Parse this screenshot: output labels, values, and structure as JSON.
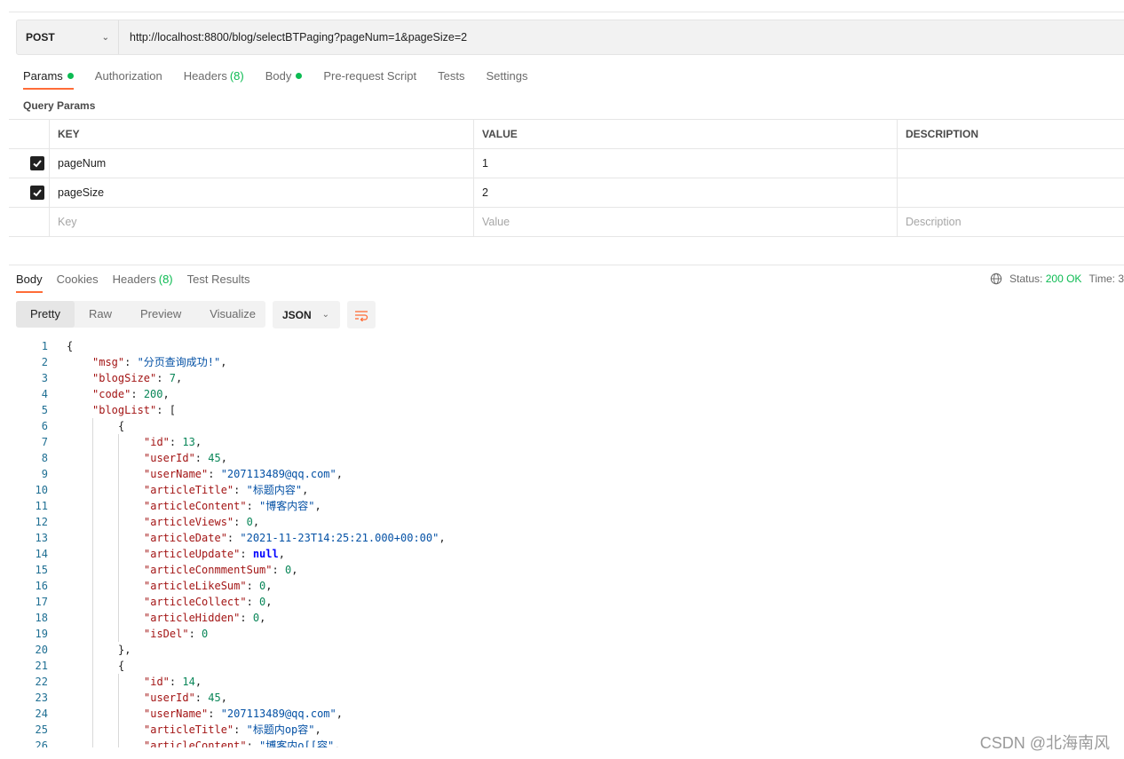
{
  "request": {
    "method": "POST",
    "url": "http://localhost:8800/blog/selectBTPaging?pageNum=1&pageSize=2"
  },
  "request_tabs": [
    {
      "label": "Params",
      "dot": true,
      "active": true
    },
    {
      "label": "Authorization"
    },
    {
      "label": "Headers",
      "count": "(8)"
    },
    {
      "label": "Body",
      "dot": true
    },
    {
      "label": "Pre-request Script"
    },
    {
      "label": "Tests"
    },
    {
      "label": "Settings"
    }
  ],
  "query_params": {
    "title": "Query Params",
    "headers": [
      "KEY",
      "VALUE",
      "DESCRIPTION"
    ],
    "rows": [
      {
        "checked": true,
        "key": "pageNum",
        "value": "1",
        "description": ""
      },
      {
        "checked": true,
        "key": "pageSize",
        "value": "2",
        "description": ""
      }
    ],
    "placeholders": {
      "key": "Key",
      "value": "Value",
      "description": "Description"
    }
  },
  "response_tabs": [
    {
      "label": "Body",
      "active": true
    },
    {
      "label": "Cookies"
    },
    {
      "label": "Headers",
      "count": "(8)"
    },
    {
      "label": "Test Results"
    }
  ],
  "status": {
    "label": "Status:",
    "value": "200 OK",
    "time_label": "Time: 3"
  },
  "view_modes": [
    "Pretty",
    "Raw",
    "Preview",
    "Visualize"
  ],
  "format": "JSON",
  "icons": {
    "method_dropdown": "chevron-down-icon",
    "format_dropdown": "chevron-down-icon",
    "wrap": "wrap-lines-icon",
    "globe": "globe-icon",
    "check": "check-icon"
  },
  "colors": {
    "accent": "#ff6c37",
    "success": "#0cbb52"
  },
  "code_lines": [
    {
      "n": "1",
      "ind": 0,
      "p": [
        [
          "p",
          "{"
        ]
      ]
    },
    {
      "n": "2",
      "ind": 1,
      "p": [
        [
          "k",
          "\"msg\""
        ],
        [
          "p",
          ": "
        ],
        [
          "s",
          "\"分页查询成功!\""
        ],
        [
          "p",
          ","
        ]
      ]
    },
    {
      "n": "3",
      "ind": 1,
      "p": [
        [
          "k",
          "\"blogSize\""
        ],
        [
          "p",
          ": "
        ],
        [
          "n",
          "7"
        ],
        [
          "p",
          ","
        ]
      ]
    },
    {
      "n": "4",
      "ind": 1,
      "p": [
        [
          "k",
          "\"code\""
        ],
        [
          "p",
          ": "
        ],
        [
          "n",
          "200"
        ],
        [
          "p",
          ","
        ]
      ]
    },
    {
      "n": "5",
      "ind": 1,
      "p": [
        [
          "k",
          "\"blogList\""
        ],
        [
          "p",
          ": ["
        ]
      ]
    },
    {
      "n": "6",
      "ind": 2,
      "p": [
        [
          "p",
          "{"
        ]
      ]
    },
    {
      "n": "7",
      "ind": 3,
      "p": [
        [
          "k",
          "\"id\""
        ],
        [
          "p",
          ": "
        ],
        [
          "n",
          "13"
        ],
        [
          "p",
          ","
        ]
      ]
    },
    {
      "n": "8",
      "ind": 3,
      "p": [
        [
          "k",
          "\"userId\""
        ],
        [
          "p",
          ": "
        ],
        [
          "n",
          "45"
        ],
        [
          "p",
          ","
        ]
      ]
    },
    {
      "n": "9",
      "ind": 3,
      "p": [
        [
          "k",
          "\"userName\""
        ],
        [
          "p",
          ": "
        ],
        [
          "s",
          "\"207113489@qq.com\""
        ],
        [
          "p",
          ","
        ]
      ]
    },
    {
      "n": "10",
      "ind": 3,
      "p": [
        [
          "k",
          "\"articleTitle\""
        ],
        [
          "p",
          ": "
        ],
        [
          "s",
          "\"标题内容\""
        ],
        [
          "p",
          ","
        ]
      ]
    },
    {
      "n": "11",
      "ind": 3,
      "p": [
        [
          "k",
          "\"articleContent\""
        ],
        [
          "p",
          ": "
        ],
        [
          "s",
          "\"博客内容\""
        ],
        [
          "p",
          ","
        ]
      ]
    },
    {
      "n": "12",
      "ind": 3,
      "p": [
        [
          "k",
          "\"articleViews\""
        ],
        [
          "p",
          ": "
        ],
        [
          "n",
          "0"
        ],
        [
          "p",
          ","
        ]
      ]
    },
    {
      "n": "13",
      "ind": 3,
      "p": [
        [
          "k",
          "\"articleDate\""
        ],
        [
          "p",
          ": "
        ],
        [
          "s",
          "\"2021-11-23T14:25:21.000+00:00\""
        ],
        [
          "p",
          ","
        ]
      ]
    },
    {
      "n": "14",
      "ind": 3,
      "p": [
        [
          "k",
          "\"articleUpdate\""
        ],
        [
          "p",
          ": "
        ],
        [
          "kw",
          "null"
        ],
        [
          "p",
          ","
        ]
      ]
    },
    {
      "n": "15",
      "ind": 3,
      "p": [
        [
          "k",
          "\"articleConmmentSum\""
        ],
        [
          "p",
          ": "
        ],
        [
          "n",
          "0"
        ],
        [
          "p",
          ","
        ]
      ]
    },
    {
      "n": "16",
      "ind": 3,
      "p": [
        [
          "k",
          "\"articleLikeSum\""
        ],
        [
          "p",
          ": "
        ],
        [
          "n",
          "0"
        ],
        [
          "p",
          ","
        ]
      ]
    },
    {
      "n": "17",
      "ind": 3,
      "p": [
        [
          "k",
          "\"articleCollect\""
        ],
        [
          "p",
          ": "
        ],
        [
          "n",
          "0"
        ],
        [
          "p",
          ","
        ]
      ]
    },
    {
      "n": "18",
      "ind": 3,
      "p": [
        [
          "k",
          "\"articleHidden\""
        ],
        [
          "p",
          ": "
        ],
        [
          "n",
          "0"
        ],
        [
          "p",
          ","
        ]
      ]
    },
    {
      "n": "19",
      "ind": 3,
      "p": [
        [
          "k",
          "\"isDel\""
        ],
        [
          "p",
          ": "
        ],
        [
          "n",
          "0"
        ]
      ]
    },
    {
      "n": "20",
      "ind": 2,
      "p": [
        [
          "p",
          "},"
        ]
      ]
    },
    {
      "n": "21",
      "ind": 2,
      "p": [
        [
          "p",
          "{"
        ]
      ]
    },
    {
      "n": "22",
      "ind": 3,
      "p": [
        [
          "k",
          "\"id\""
        ],
        [
          "p",
          ": "
        ],
        [
          "n",
          "14"
        ],
        [
          "p",
          ","
        ]
      ]
    },
    {
      "n": "23",
      "ind": 3,
      "p": [
        [
          "k",
          "\"userId\""
        ],
        [
          "p",
          ": "
        ],
        [
          "n",
          "45"
        ],
        [
          "p",
          ","
        ]
      ]
    },
    {
      "n": "24",
      "ind": 3,
      "p": [
        [
          "k",
          "\"userName\""
        ],
        [
          "p",
          ": "
        ],
        [
          "s",
          "\"207113489@qq.com\""
        ],
        [
          "p",
          ","
        ]
      ]
    },
    {
      "n": "25",
      "ind": 3,
      "p": [
        [
          "k",
          "\"articleTitle\""
        ],
        [
          "p",
          ": "
        ],
        [
          "s",
          "\"标题内op容\""
        ],
        [
          "p",
          ","
        ]
      ]
    },
    {
      "n": "26",
      "ind": 3,
      "p": [
        [
          "k",
          "\"articleContent\""
        ],
        [
          "p",
          ": "
        ],
        [
          "s",
          "\"博客内o[[容\""
        ],
        [
          "p",
          ","
        ]
      ]
    }
  ],
  "watermark": "CSDN @北海南风"
}
